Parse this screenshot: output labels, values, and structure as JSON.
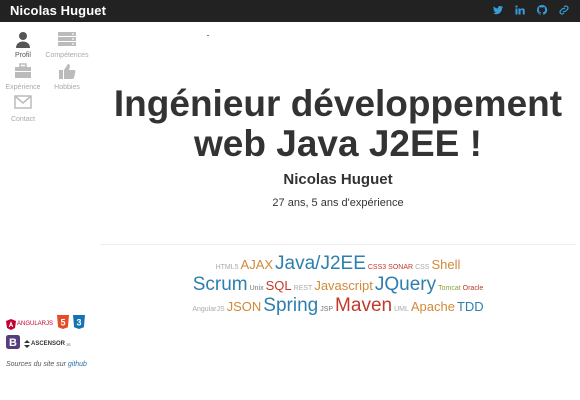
{
  "header": {
    "brand": "Nicolas Huguet",
    "icons": [
      "twitter-icon",
      "linkedin-icon",
      "github-icon",
      "link-icon"
    ]
  },
  "sidebar": {
    "items": [
      {
        "label": "Profil",
        "icon": "user-icon",
        "active": true
      },
      {
        "label": "Compétences",
        "icon": "server-icon",
        "active": false
      },
      {
        "label": "Expérience",
        "icon": "briefcase-icon",
        "active": false
      },
      {
        "label": "Hobbies",
        "icon": "thumbs-up-icon",
        "active": false
      },
      {
        "label": "Contact",
        "icon": "envelope-icon",
        "active": false
      }
    ],
    "badges": {
      "angular": "ANGULARJS",
      "html5": "5",
      "css3": "3",
      "bootstrap": "B",
      "ascensor": "ASCENSOR",
      "ascensor_suffix": "JS"
    },
    "sources_prefix": "Sources du site sur ",
    "sources_link": "github"
  },
  "main": {
    "title_line1": "Ingénieur développement",
    "title_line2": "web Java J2EE !",
    "name": "Nicolas Huguet",
    "experience": "27 ans, 5 ans d'expérience"
  },
  "cloud": {
    "rows": [
      [
        {
          "text": "HTML5",
          "color": "#aaaaaa",
          "size": 7
        },
        {
          "text": "AJAX",
          "color": "#d08a3a",
          "size": 13
        },
        {
          "text": "Java/J2EE",
          "color": "#2e7fae",
          "size": 19
        },
        {
          "text": "CSS3",
          "color": "#c0392b",
          "size": 7
        },
        {
          "text": "SONAR",
          "color": "#c0392b",
          "size": 7
        },
        {
          "text": "CSS",
          "color": "#aaaaaa",
          "size": 7
        },
        {
          "text": "Shell",
          "color": "#d08a3a",
          "size": 13
        }
      ],
      [
        {
          "text": "Scrum",
          "color": "#2e7fae",
          "size": 19
        },
        {
          "text": "Unix",
          "color": "#777777",
          "size": 7
        },
        {
          "text": "SQL",
          "color": "#c0392b",
          "size": 13
        },
        {
          "text": "REST",
          "color": "#aaaaaa",
          "size": 7
        },
        {
          "text": "Javascript",
          "color": "#d08a3a",
          "size": 13
        },
        {
          "text": "JQuery",
          "color": "#2e7fae",
          "size": 19
        },
        {
          "text": "Tomcat",
          "color": "#8aa33a",
          "size": 7
        },
        {
          "text": "Oracle",
          "color": "#c0392b",
          "size": 7
        }
      ],
      [
        {
          "text": "AngularJS",
          "color": "#aaaaaa",
          "size": 7
        },
        {
          "text": "JSON",
          "color": "#d08a3a",
          "size": 13
        },
        {
          "text": "Spring",
          "color": "#2e7fae",
          "size": 19
        },
        {
          "text": "JSP",
          "color": "#777777",
          "size": 7
        },
        {
          "text": "Maven",
          "color": "#c0392b",
          "size": 19
        },
        {
          "text": "UML",
          "color": "#aaaaaa",
          "size": 7
        },
        {
          "text": "Apache",
          "color": "#d08a3a",
          "size": 13
        },
        {
          "text": "TDD",
          "color": "#2e7fae",
          "size": 13
        }
      ]
    ]
  }
}
